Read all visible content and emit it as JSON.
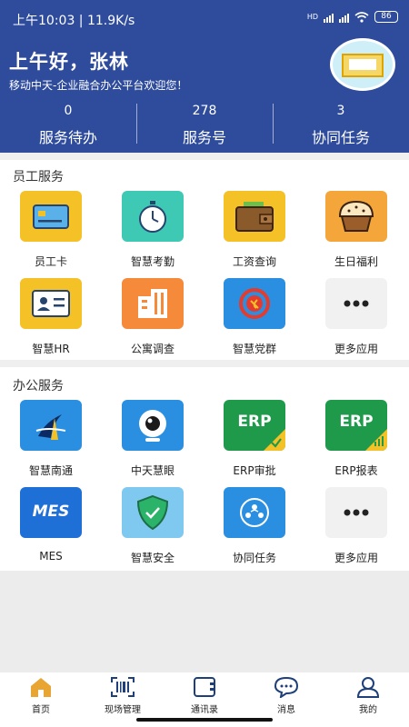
{
  "status": {
    "time": "上午10:03 | 11.9K/s",
    "battery": "86"
  },
  "header": {
    "greeting": "上午好，张林",
    "subtitle": "移动中天-企业融合办公平台欢迎您！",
    "stats": [
      {
        "value": "0",
        "label": "服务待办"
      },
      {
        "value": "278",
        "label": "服务号"
      },
      {
        "value": "3",
        "label": "协同任务"
      }
    ]
  },
  "employee_services": {
    "title": "员工服务",
    "items": [
      {
        "label": "员工卡",
        "icon": "id-card-icon"
      },
      {
        "label": "智慧考勤",
        "icon": "stopwatch-icon"
      },
      {
        "label": "工资查询",
        "icon": "wallet-icon"
      },
      {
        "label": "生日福利",
        "icon": "cupcake-icon"
      },
      {
        "label": "智慧HR",
        "icon": "person-card-icon"
      },
      {
        "label": "公寓调查",
        "icon": "building-icon"
      },
      {
        "label": "智慧党群",
        "icon": "party-emblem-icon"
      },
      {
        "label": "更多应用",
        "icon": "more-icon"
      }
    ]
  },
  "office_services": {
    "title": "办公服务",
    "items": [
      {
        "label": "智慧南通",
        "icon": "nantong-logo-icon"
      },
      {
        "label": "中天慧眼",
        "icon": "camera-eye-icon"
      },
      {
        "label": "ERP审批",
        "icon": "erp-approve-icon",
        "tile_text": "ERP"
      },
      {
        "label": "ERP报表",
        "icon": "erp-report-icon",
        "tile_text": "ERP"
      },
      {
        "label": "MES",
        "icon": "mes-icon",
        "tile_text": "MES"
      },
      {
        "label": "智慧安全",
        "icon": "shield-icon"
      },
      {
        "label": "协同任务",
        "icon": "team-task-icon"
      },
      {
        "label": "更多应用",
        "icon": "more-icon"
      }
    ]
  },
  "tabbar": [
    {
      "label": "首页",
      "icon": "home-icon",
      "active": true
    },
    {
      "label": "现场管理",
      "icon": "scan-icon"
    },
    {
      "label": "通讯录",
      "icon": "contacts-icon"
    },
    {
      "label": "消息",
      "icon": "message-icon"
    },
    {
      "label": "我的",
      "icon": "profile-icon"
    }
  ],
  "colors": {
    "header": "#2f4c9c",
    "tab_active": "#e8a531"
  }
}
